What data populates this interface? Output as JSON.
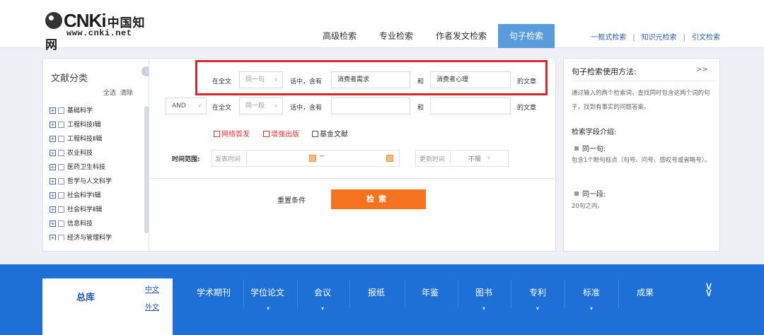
{
  "logo": {
    "brand": "CNKi",
    "cn": "中国知网",
    "url": "www.cnki.net"
  },
  "tabs": [
    "高级检索",
    "专业检索",
    "作者发文检索",
    "句子检索"
  ],
  "active_tab": "句子检索",
  "top_links": [
    "一框式检索",
    "知识元检索",
    "引文检索"
  ],
  "left": {
    "title": "文献分类",
    "select_all": "全选",
    "clear": "清除",
    "categories": [
      "基础科学",
      "工程科技Ⅰ辑",
      "工程科技Ⅱ辑",
      "农业科技",
      "医药卫生科技",
      "哲学与人文科学",
      "社会科学Ⅰ辑",
      "社会科学Ⅱ辑",
      "信息科技",
      "经济与管理科学"
    ]
  },
  "row1": {
    "scope": "在全文",
    "unit": "同一句",
    "contains": "话中，含有",
    "term1": "消费者需求",
    "and": "和",
    "term2": "消费者心理",
    "suffix": "的文章"
  },
  "row2": {
    "logic": "AND",
    "scope": "在全文",
    "unit": "同一段",
    "contains": "话中，含有",
    "term1": "",
    "and": "和",
    "term2": "",
    "suffix": "的文章"
  },
  "checkboxes": [
    "网络首发",
    "增强出版",
    "基金文献"
  ],
  "time": {
    "label": "时间范围:",
    "publish_placeholder": "发表时间",
    "dash": "--",
    "update_label": "更新时间",
    "update_value": "不限"
  },
  "actions": {
    "reset": "重置条件",
    "search": "检索"
  },
  "help": {
    "title": "句子检索使用方法:",
    "more": ">>",
    "intro": "通过输入的两个检索词，查找同时包含这两个词的句子，找到有事实的问题答案。",
    "fields_title": "检索字段介绍:",
    "sentence_title": "同一句:",
    "sentence_desc": "包含1个断句标点（句号、问号、感叹号或省略号）。",
    "paragraph_title": "同一段:",
    "paragraph_desc": "20句之内。"
  },
  "bottom": {
    "zongku": "总库",
    "lang_cn": "中文",
    "lang_en": "外文",
    "nav": [
      "学术期刊",
      "学位论文",
      "会议",
      "报纸",
      "年鉴",
      "图书",
      "专利",
      "标准",
      "成果"
    ]
  },
  "colors": {
    "brand_blue": "#1f70d6",
    "active_tab": "#5a9bdb",
    "search_btn": "#f5731f",
    "highlight": "#d9262c"
  }
}
